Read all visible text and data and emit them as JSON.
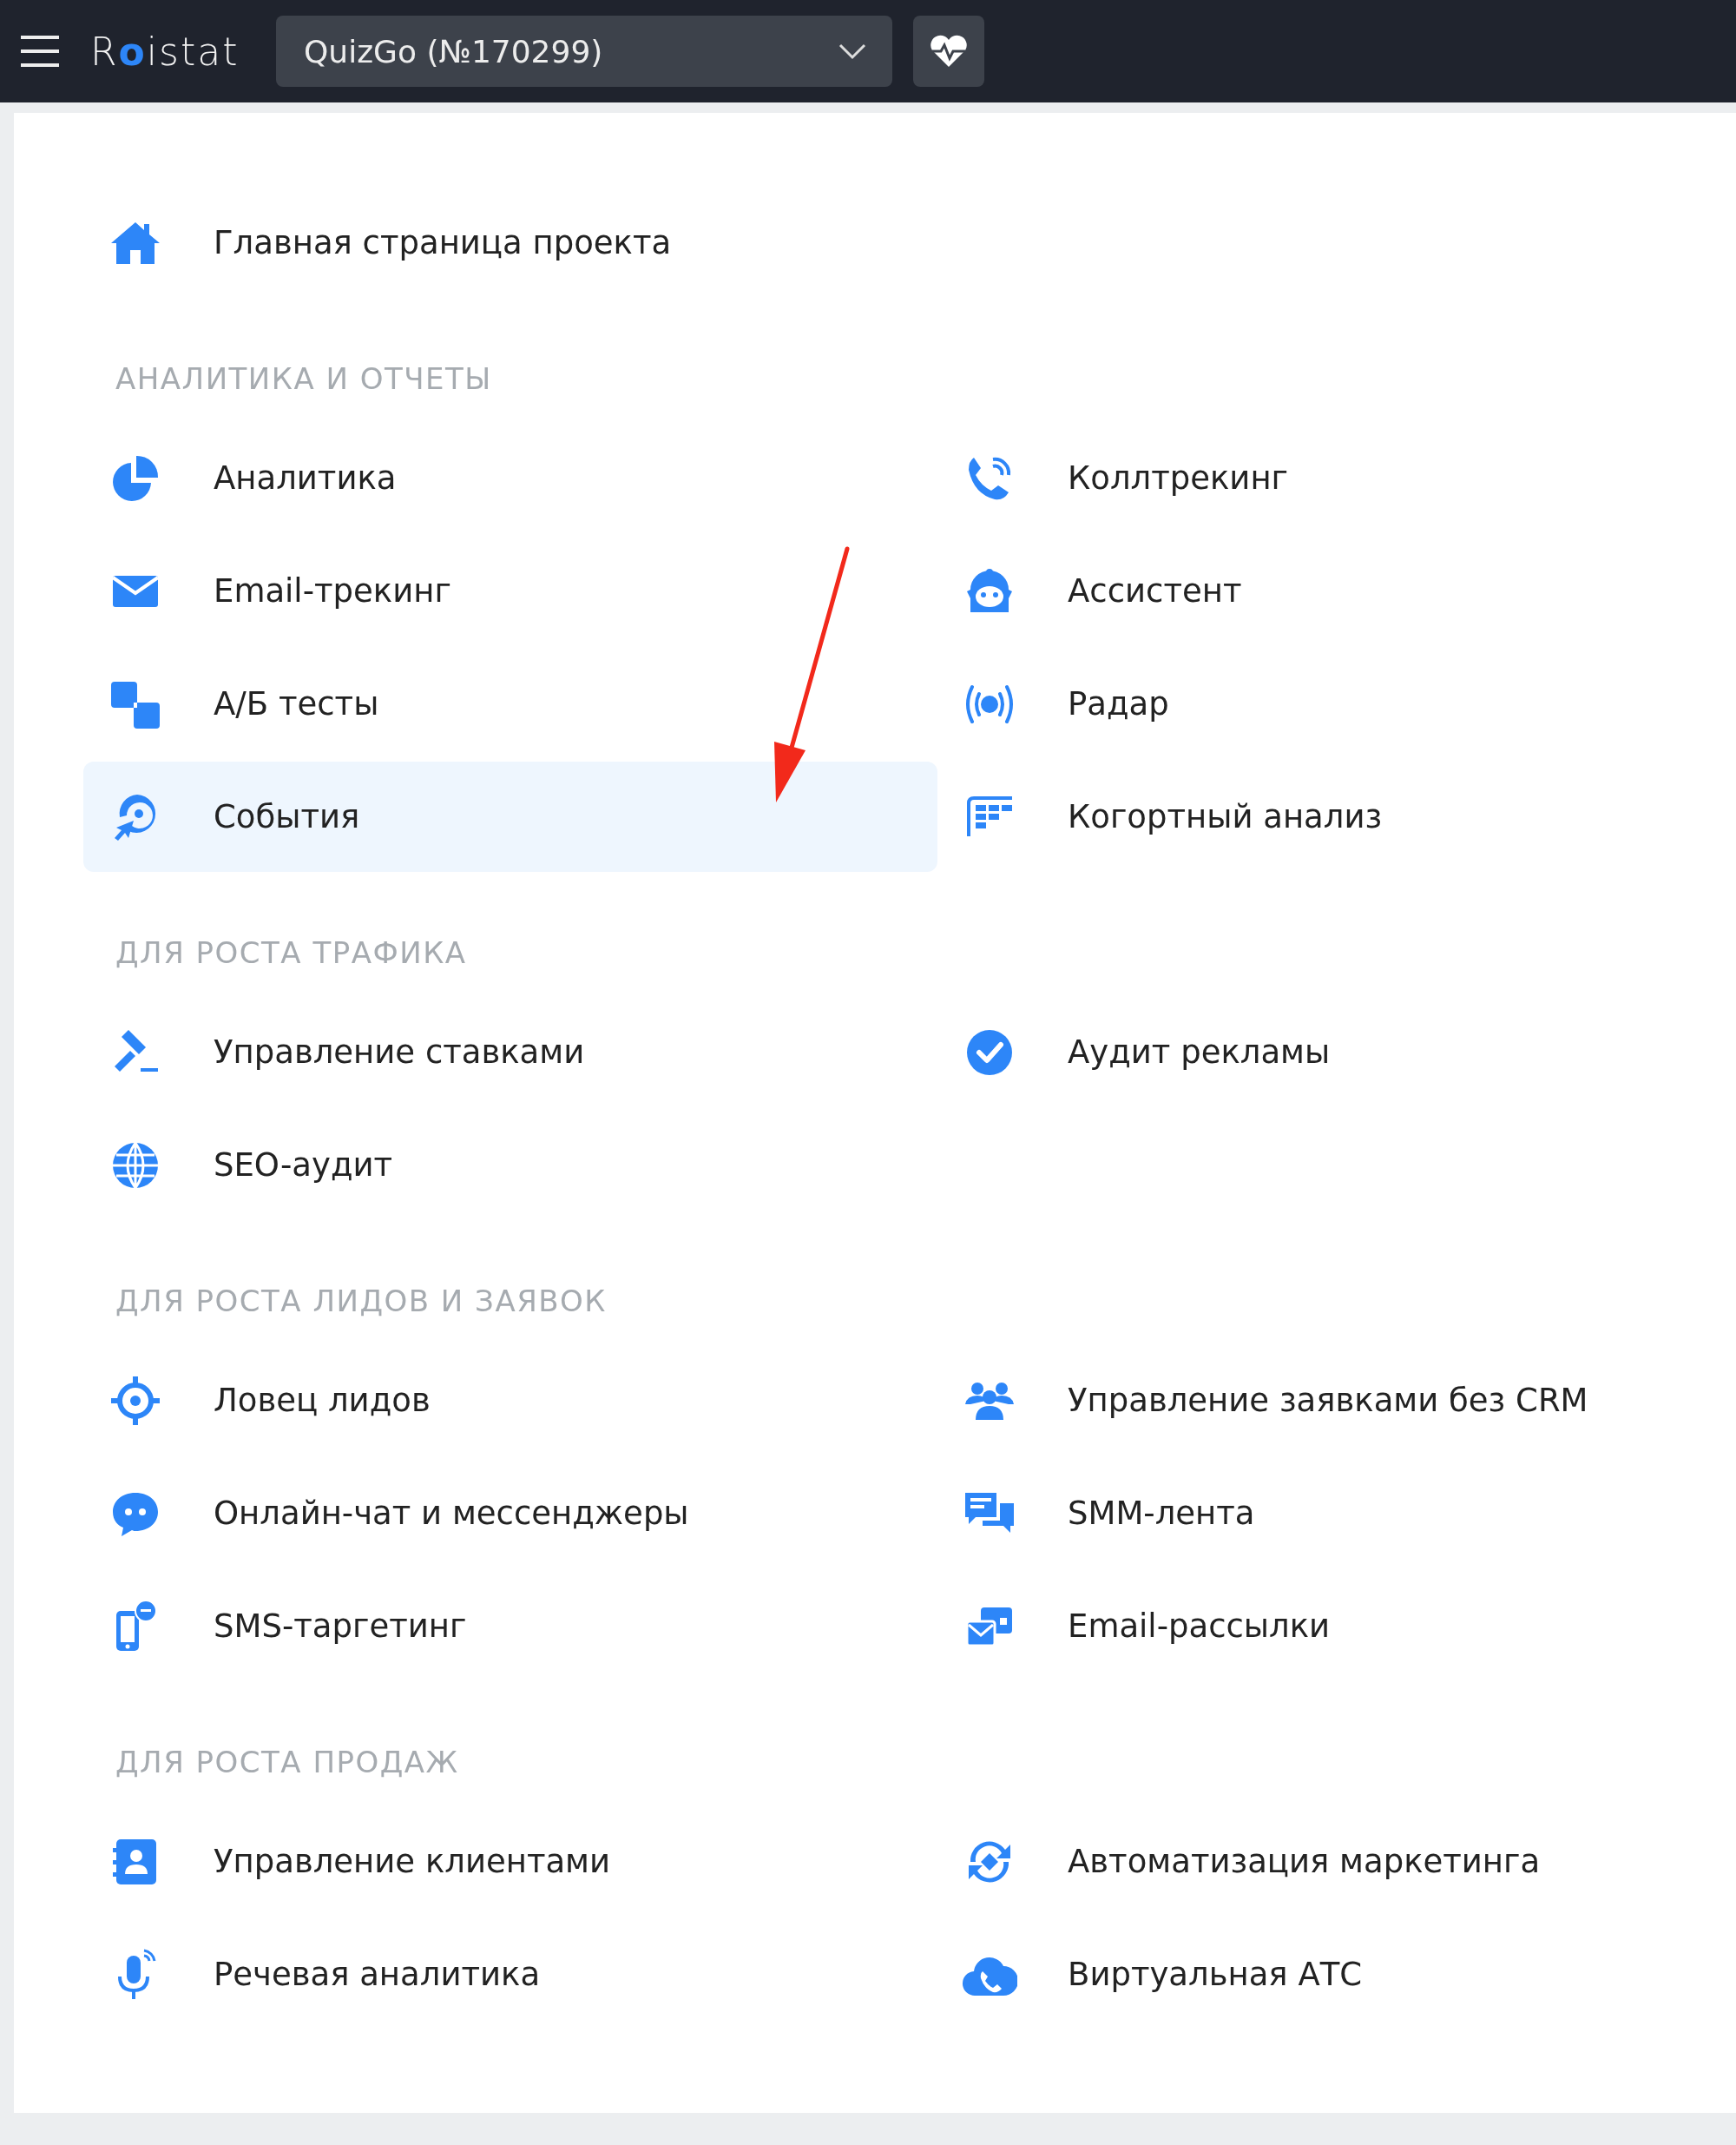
{
  "topbar": {
    "logo": "Roistat",
    "project_select": {
      "value": "QuizGo (№170299)"
    }
  },
  "menu": {
    "home": {
      "label": "Главная страница проекта",
      "selected": false
    },
    "sections": [
      {
        "title": "АНАЛИТИКА И ОТЧЕТЫ",
        "items": [
          {
            "label": "Аналитика",
            "selected": false
          },
          {
            "label": "Коллтрекинг",
            "selected": false
          },
          {
            "label": "Email-трекинг",
            "selected": false
          },
          {
            "label": "Ассистент",
            "selected": false
          },
          {
            "label": "А/Б тесты",
            "selected": false
          },
          {
            "label": "Радар",
            "selected": false
          },
          {
            "label": "События",
            "selected": true
          },
          {
            "label": "Когортный анализ",
            "selected": false
          }
        ]
      },
      {
        "title": "ДЛЯ РОСТА ТРАФИКА",
        "items": [
          {
            "label": "Управление ставками",
            "selected": false
          },
          {
            "label": "Аудит рекламы",
            "selected": false
          },
          {
            "label": "SEO-аудит",
            "selected": false
          }
        ]
      },
      {
        "title": "ДЛЯ РОСТА ЛИДОВ И ЗАЯВОК",
        "items": [
          {
            "label": "Ловец лидов",
            "selected": false
          },
          {
            "label": "Управление заявками без CRM",
            "selected": false
          },
          {
            "label": "Онлайн-чат и мессенджеры",
            "selected": false
          },
          {
            "label": "SMM-лента",
            "selected": false
          },
          {
            "label": "SMS-таргетинг",
            "selected": false
          },
          {
            "label": "Email-рассылки",
            "selected": false
          }
        ]
      },
      {
        "title": "ДЛЯ РОСТА ПРОДАЖ",
        "items": [
          {
            "label": "Управление клиентами",
            "selected": false
          },
          {
            "label": "Автоматизация маркетинга",
            "selected": false
          },
          {
            "label": "Речевая аналитика",
            "selected": false
          },
          {
            "label": "Виртуальная АТС",
            "selected": false
          }
        ]
      }
    ]
  }
}
